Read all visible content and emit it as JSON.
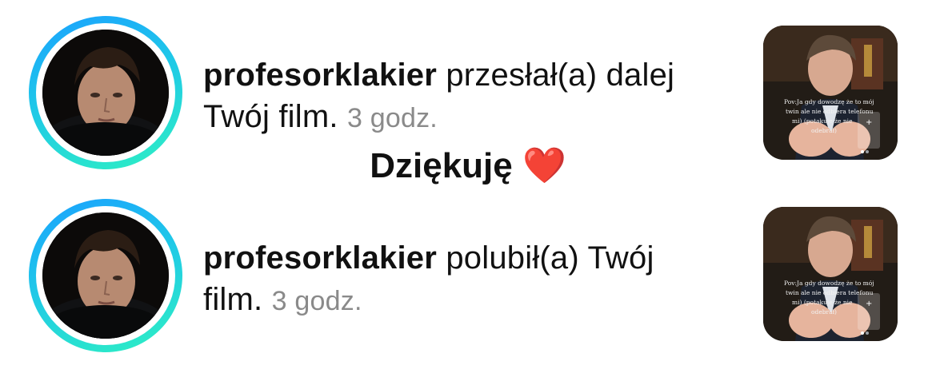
{
  "notifications": [
    {
      "username": "profesorklakier",
      "action": "przesłał(a) dalej Twój film.",
      "time": "3 godz.",
      "thumbnail_caption": [
        "Pov:Ja gdy dowodzę że to mój",
        "twin ale nie odbiera telefonu",
        "mi) (potakuje że nie",
        "odebrał)"
      ]
    },
    {
      "username": "profesorklakier",
      "action": "polubił(a) Twój film.",
      "time": "3 godz.",
      "thumbnail_caption": [
        "Pov:Ja gdy dowodzę że to mój",
        "twin ale nie odbiera telefonu",
        "mi) (potakuje że nie",
        "odebrał)"
      ]
    }
  ],
  "reply": {
    "text": "Dziękuję",
    "emoji": "❤️"
  },
  "colors": {
    "ring_start": "#1aa0ff",
    "ring_end": "#2ef0c2",
    "time_gray": "#8a8a8a",
    "heart": "#e8202a"
  },
  "icons": [
    "avatar-photo",
    "video-thumbnail",
    "heart-icon",
    "plus-icon"
  ]
}
